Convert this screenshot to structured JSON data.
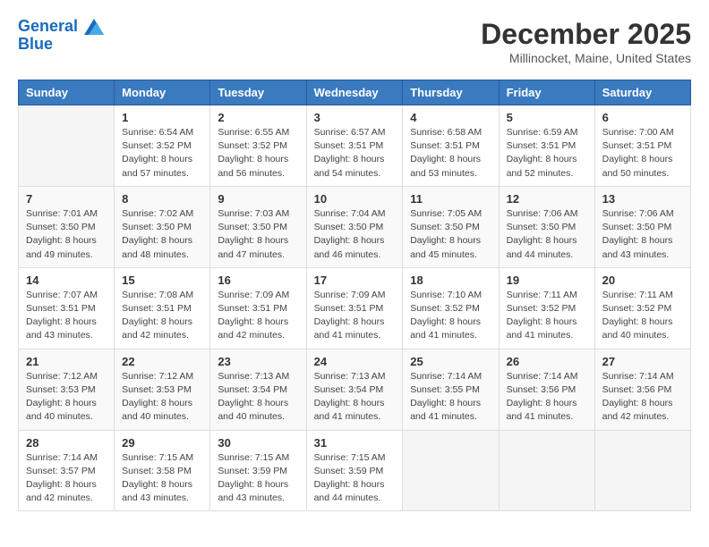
{
  "header": {
    "logo_line1": "General",
    "logo_line2": "Blue",
    "month": "December 2025",
    "location": "Millinocket, Maine, United States"
  },
  "weekdays": [
    "Sunday",
    "Monday",
    "Tuesday",
    "Wednesday",
    "Thursday",
    "Friday",
    "Saturday"
  ],
  "weeks": [
    [
      {
        "day": "",
        "sunrise": "",
        "sunset": "",
        "daylight": ""
      },
      {
        "day": "1",
        "sunrise": "6:54 AM",
        "sunset": "3:52 PM",
        "daylight": "8 hours and 57 minutes."
      },
      {
        "day": "2",
        "sunrise": "6:55 AM",
        "sunset": "3:52 PM",
        "daylight": "8 hours and 56 minutes."
      },
      {
        "day": "3",
        "sunrise": "6:57 AM",
        "sunset": "3:51 PM",
        "daylight": "8 hours and 54 minutes."
      },
      {
        "day": "4",
        "sunrise": "6:58 AM",
        "sunset": "3:51 PM",
        "daylight": "8 hours and 53 minutes."
      },
      {
        "day": "5",
        "sunrise": "6:59 AM",
        "sunset": "3:51 PM",
        "daylight": "8 hours and 52 minutes."
      },
      {
        "day": "6",
        "sunrise": "7:00 AM",
        "sunset": "3:51 PM",
        "daylight": "8 hours and 50 minutes."
      }
    ],
    [
      {
        "day": "7",
        "sunrise": "7:01 AM",
        "sunset": "3:50 PM",
        "daylight": "8 hours and 49 minutes."
      },
      {
        "day": "8",
        "sunrise": "7:02 AM",
        "sunset": "3:50 PM",
        "daylight": "8 hours and 48 minutes."
      },
      {
        "day": "9",
        "sunrise": "7:03 AM",
        "sunset": "3:50 PM",
        "daylight": "8 hours and 47 minutes."
      },
      {
        "day": "10",
        "sunrise": "7:04 AM",
        "sunset": "3:50 PM",
        "daylight": "8 hours and 46 minutes."
      },
      {
        "day": "11",
        "sunrise": "7:05 AM",
        "sunset": "3:50 PM",
        "daylight": "8 hours and 45 minutes."
      },
      {
        "day": "12",
        "sunrise": "7:06 AM",
        "sunset": "3:50 PM",
        "daylight": "8 hours and 44 minutes."
      },
      {
        "day": "13",
        "sunrise": "7:06 AM",
        "sunset": "3:50 PM",
        "daylight": "8 hours and 43 minutes."
      }
    ],
    [
      {
        "day": "14",
        "sunrise": "7:07 AM",
        "sunset": "3:51 PM",
        "daylight": "8 hours and 43 minutes."
      },
      {
        "day": "15",
        "sunrise": "7:08 AM",
        "sunset": "3:51 PM",
        "daylight": "8 hours and 42 minutes."
      },
      {
        "day": "16",
        "sunrise": "7:09 AM",
        "sunset": "3:51 PM",
        "daylight": "8 hours and 42 minutes."
      },
      {
        "day": "17",
        "sunrise": "7:09 AM",
        "sunset": "3:51 PM",
        "daylight": "8 hours and 41 minutes."
      },
      {
        "day": "18",
        "sunrise": "7:10 AM",
        "sunset": "3:52 PM",
        "daylight": "8 hours and 41 minutes."
      },
      {
        "day": "19",
        "sunrise": "7:11 AM",
        "sunset": "3:52 PM",
        "daylight": "8 hours and 41 minutes."
      },
      {
        "day": "20",
        "sunrise": "7:11 AM",
        "sunset": "3:52 PM",
        "daylight": "8 hours and 40 minutes."
      }
    ],
    [
      {
        "day": "21",
        "sunrise": "7:12 AM",
        "sunset": "3:53 PM",
        "daylight": "8 hours and 40 minutes."
      },
      {
        "day": "22",
        "sunrise": "7:12 AM",
        "sunset": "3:53 PM",
        "daylight": "8 hours and 40 minutes."
      },
      {
        "day": "23",
        "sunrise": "7:13 AM",
        "sunset": "3:54 PM",
        "daylight": "8 hours and 40 minutes."
      },
      {
        "day": "24",
        "sunrise": "7:13 AM",
        "sunset": "3:54 PM",
        "daylight": "8 hours and 41 minutes."
      },
      {
        "day": "25",
        "sunrise": "7:14 AM",
        "sunset": "3:55 PM",
        "daylight": "8 hours and 41 minutes."
      },
      {
        "day": "26",
        "sunrise": "7:14 AM",
        "sunset": "3:56 PM",
        "daylight": "8 hours and 41 minutes."
      },
      {
        "day": "27",
        "sunrise": "7:14 AM",
        "sunset": "3:56 PM",
        "daylight": "8 hours and 42 minutes."
      }
    ],
    [
      {
        "day": "28",
        "sunrise": "7:14 AM",
        "sunset": "3:57 PM",
        "daylight": "8 hours and 42 minutes."
      },
      {
        "day": "29",
        "sunrise": "7:15 AM",
        "sunset": "3:58 PM",
        "daylight": "8 hours and 43 minutes."
      },
      {
        "day": "30",
        "sunrise": "7:15 AM",
        "sunset": "3:59 PM",
        "daylight": "8 hours and 43 minutes."
      },
      {
        "day": "31",
        "sunrise": "7:15 AM",
        "sunset": "3:59 PM",
        "daylight": "8 hours and 44 minutes."
      },
      {
        "day": "",
        "sunrise": "",
        "sunset": "",
        "daylight": ""
      },
      {
        "day": "",
        "sunrise": "",
        "sunset": "",
        "daylight": ""
      },
      {
        "day": "",
        "sunrise": "",
        "sunset": "",
        "daylight": ""
      }
    ]
  ]
}
